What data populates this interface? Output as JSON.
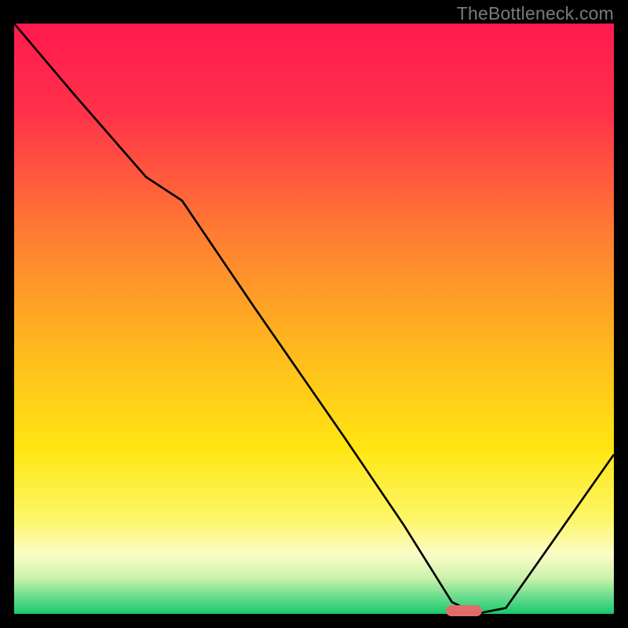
{
  "watermark": "TheBottleneck.com",
  "colors": {
    "gradient_stops": [
      {
        "pos": 0.0,
        "color": "#ff1a4e"
      },
      {
        "pos": 0.15,
        "color": "#ff314a"
      },
      {
        "pos": 0.35,
        "color": "#ff7a33"
      },
      {
        "pos": 0.55,
        "color": "#ffb91e"
      },
      {
        "pos": 0.72,
        "color": "#ffe612"
      },
      {
        "pos": 0.84,
        "color": "#fdf66a"
      },
      {
        "pos": 0.9,
        "color": "#fbfcc8"
      },
      {
        "pos": 0.94,
        "color": "#c9f2a9"
      },
      {
        "pos": 0.975,
        "color": "#5fd98b"
      },
      {
        "pos": 1.0,
        "color": "#19c96a"
      }
    ],
    "curve": "#000000",
    "marker": "#e36b6e",
    "background": "#000000"
  },
  "chart_data": {
    "type": "line",
    "title": "",
    "xlabel": "",
    "ylabel": "",
    "xlim": [
      0,
      100
    ],
    "ylim": [
      0,
      100
    ],
    "grid": false,
    "legend": false,
    "series": [
      {
        "name": "bottleneck-curve",
        "x": [
          0,
          10,
          22,
          28,
          40,
          55,
          65,
          73,
          77,
          82,
          100
        ],
        "y": [
          100,
          88,
          74,
          70,
          52,
          30,
          15,
          2,
          0,
          1,
          27
        ]
      }
    ],
    "marker": {
      "x": 75,
      "y": 0.5
    },
    "notes": "x is normalized horizontal position (0=left edge of plot, 100=right). y is normalized height (0=bottom/green, 100=top/red). Curve starts at top-left, dips to near-zero around x≈75–80, then rises toward the right edge."
  }
}
